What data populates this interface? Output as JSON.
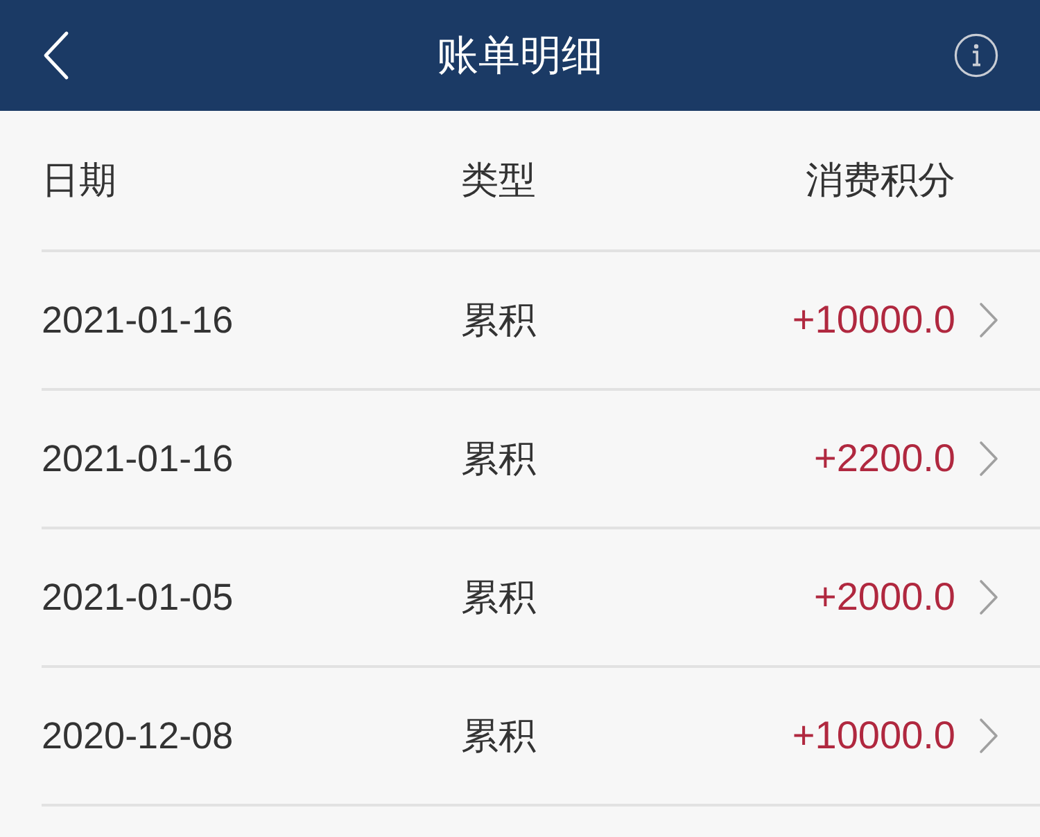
{
  "nav_bar": {
    "title": "账单明细"
  },
  "table": {
    "columns": [
      "日期",
      "类型",
      "消费积分"
    ],
    "rows": [
      {
        "date": "2021-01-16",
        "type": "累积",
        "points": "+10000.0"
      },
      {
        "date": "2021-01-16",
        "type": "累积",
        "points": "+2200.0"
      },
      {
        "date": "2021-01-05",
        "type": "累积",
        "points": "+2000.0"
      },
      {
        "date": "2020-12-08",
        "type": "累积",
        "points": "+10000.0"
      }
    ]
  }
}
